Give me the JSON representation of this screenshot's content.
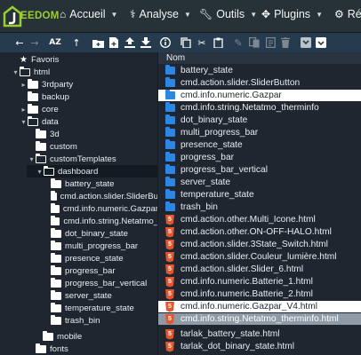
{
  "brand": {
    "logo_text": "EEDOM",
    "accent_color": "#9acd2f"
  },
  "nav": [
    {
      "label": "Accueil",
      "icon": "home-icon"
    },
    {
      "label": "Analyse",
      "icon": "stethoscope-icon"
    },
    {
      "label": "Outils",
      "icon": "wrench-icon"
    },
    {
      "label": "Plugins",
      "icon": "puzzle-icon"
    },
    {
      "label": "Régl",
      "icon": "gear-icon"
    }
  ],
  "toolbar": {
    "buttons": [
      "arrow-left-icon",
      "arrow-right-icon",
      "sort-az-icon",
      "arrow-up-icon",
      "new-folder-icon",
      "new-file-icon",
      "upload-icon",
      "download-icon",
      "info-icon",
      "copy-icon",
      "cut-icon",
      "paste-icon",
      "edit-icon",
      "duplicate-icon",
      "rename-icon",
      "delete-icon",
      "view-list-icon",
      "view-grid-icon"
    ],
    "sort_label": "AZ"
  },
  "tree": [
    {
      "label": "Favoris",
      "indent": 0,
      "kind": "star",
      "toggle": ""
    },
    {
      "label": "html",
      "indent": 0,
      "kind": "open",
      "toggle": "▾"
    },
    {
      "label": "3rdparty",
      "indent": 1,
      "kind": "folder",
      "toggle": "▸"
    },
    {
      "label": "backup",
      "indent": 1,
      "kind": "folder",
      "toggle": ""
    },
    {
      "label": "core",
      "indent": 1,
      "kind": "folder",
      "toggle": "▸"
    },
    {
      "label": "data",
      "indent": 1,
      "kind": "open",
      "toggle": "▾"
    },
    {
      "label": "3d",
      "indent": 2,
      "kind": "folder",
      "toggle": ""
    },
    {
      "label": "custom",
      "indent": 2,
      "kind": "folder",
      "toggle": ""
    },
    {
      "label": "customTemplates",
      "indent": 2,
      "kind": "open",
      "toggle": "▾"
    },
    {
      "label": "dashboard",
      "indent": 3,
      "kind": "open",
      "toggle": "▾",
      "selected": true
    },
    {
      "label": "battery_state",
      "indent": 4,
      "kind": "folder",
      "toggle": ""
    },
    {
      "label": "cmd.action.slider.SliderBu",
      "indent": 4,
      "kind": "folder",
      "toggle": ""
    },
    {
      "label": "cmd.info.numeric.Gazpar",
      "indent": 4,
      "kind": "folder",
      "toggle": ""
    },
    {
      "label": "cmd.info.string.Netatmo_",
      "indent": 4,
      "kind": "folder",
      "toggle": ""
    },
    {
      "label": "dot_binary_state",
      "indent": 4,
      "kind": "folder",
      "toggle": ""
    },
    {
      "label": "multi_progress_bar",
      "indent": 4,
      "kind": "folder",
      "toggle": ""
    },
    {
      "label": "presence_state",
      "indent": 4,
      "kind": "folder",
      "toggle": ""
    },
    {
      "label": "progress_bar",
      "indent": 4,
      "kind": "folder",
      "toggle": ""
    },
    {
      "label": "progress_bar_vertical",
      "indent": 4,
      "kind": "folder",
      "toggle": ""
    },
    {
      "label": "server_state",
      "indent": 4,
      "kind": "folder",
      "toggle": ""
    },
    {
      "label": "temperature_state",
      "indent": 4,
      "kind": "folder",
      "toggle": ""
    },
    {
      "label": "trash_bin",
      "indent": 4,
      "kind": "folder",
      "toggle": ""
    },
    {
      "label": "mobile",
      "indent": 3,
      "kind": "folder",
      "toggle": ""
    },
    {
      "label": "fonts",
      "indent": 2,
      "kind": "folder",
      "toggle": ""
    }
  ],
  "list": {
    "header": "Nom",
    "items": [
      {
        "label": "battery_state",
        "type": "folder"
      },
      {
        "label": "cmd.action.slider.SliderButton",
        "type": "folder"
      },
      {
        "label": "cmd.info.numeric.Gazpar",
        "type": "folder",
        "state": "light"
      },
      {
        "label": "cmd.info.string.Netatmo_therminfo",
        "type": "folder"
      },
      {
        "label": "dot_binary_state",
        "type": "folder"
      },
      {
        "label": "multi_progress_bar",
        "type": "folder"
      },
      {
        "label": "presence_state",
        "type": "folder"
      },
      {
        "label": "progress_bar",
        "type": "folder"
      },
      {
        "label": "progress_bar_vertical",
        "type": "folder"
      },
      {
        "label": "server_state",
        "type": "folder"
      },
      {
        "label": "temperature_state",
        "type": "folder"
      },
      {
        "label": "trash_bin",
        "type": "folder"
      },
      {
        "label": "cmd.action.other.Multi_Icone.html",
        "type": "html"
      },
      {
        "label": "cmd.action.other.ON-OFF-HALO.html",
        "type": "html"
      },
      {
        "label": "cmd.action.slider.3State_Switch.html",
        "type": "html"
      },
      {
        "label": "cmd.action.slider.Couleur_lumière.html",
        "type": "html"
      },
      {
        "label": "cmd.action.slider.Slider_6.html",
        "type": "html"
      },
      {
        "label": "cmd.info.numeric.Batterie_1.html",
        "type": "html"
      },
      {
        "label": "cmd.info.numeric.Batterie_2.html",
        "type": "html"
      },
      {
        "label": "cmd.info.numeric.Gazpar_V4.html",
        "type": "html",
        "state": "light"
      },
      {
        "label": "cmd.info.string.Netatmo_therminfo.html",
        "type": "html",
        "state": "grey"
      },
      {
        "label": "tarlak_battery_state.html",
        "type": "html"
      },
      {
        "label": "tarlak_dot_binary_state.html",
        "type": "html"
      }
    ]
  }
}
